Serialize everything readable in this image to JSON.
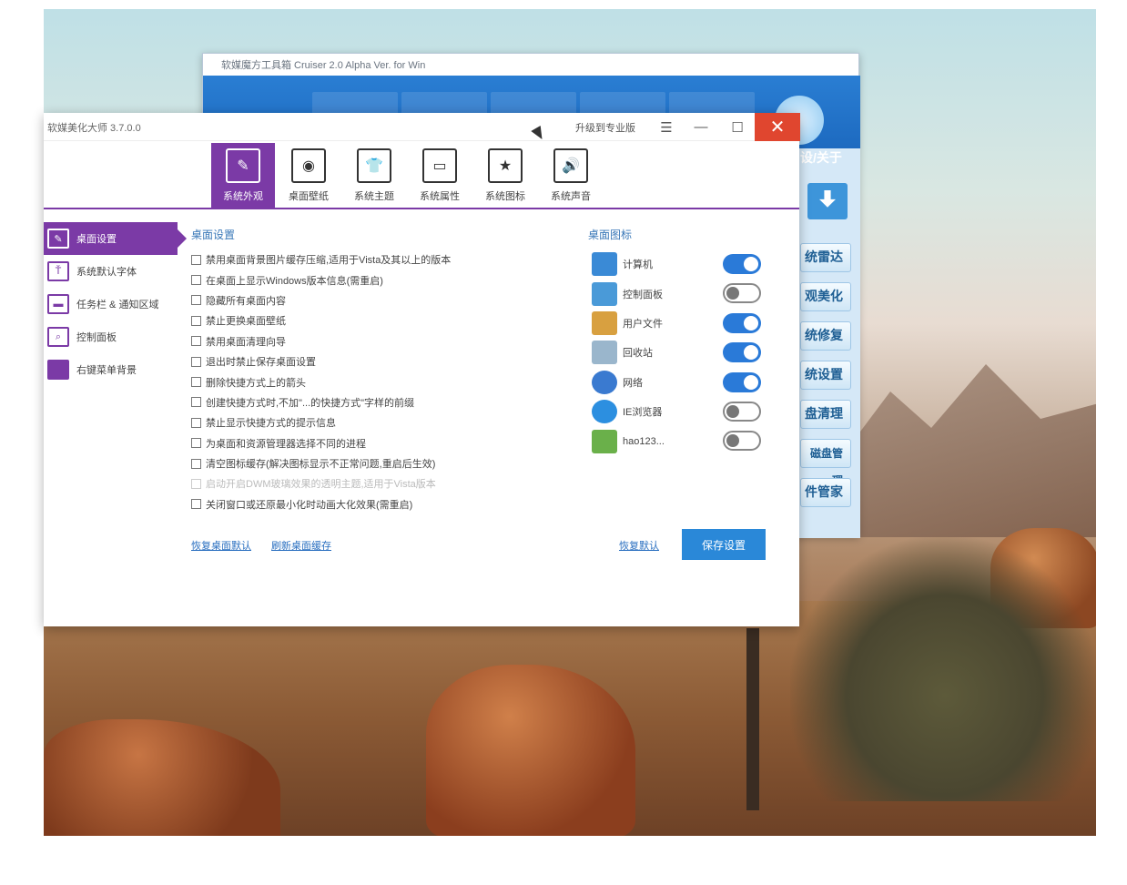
{
  "bg_window": {
    "title": "软媒魔方工具箱 Cruiser 2.0 Alpha Ver. for Win",
    "about": "设/关于",
    "side_buttons": [
      "统雷达",
      "观美化",
      "统修复",
      "统设置",
      "盘清理",
      "磁盘管理",
      "件管家"
    ]
  },
  "window": {
    "title": "软媒美化大师 3.7.0.0",
    "upgrade_link": "升级到专业版",
    "menu_icon": "menu-icon",
    "minimize_icon": "minimize-icon",
    "maximize_icon": "maximize-icon",
    "close_icon": "close-icon",
    "close_color": "#e0462f",
    "accent_color": "#7b3aa6"
  },
  "top_tabs": [
    {
      "label": "系统外观",
      "icon": "brush-icon",
      "glyph": "✎"
    },
    {
      "label": "桌面壁纸",
      "icon": "wallpaper-icon",
      "glyph": "◉"
    },
    {
      "label": "系统主题",
      "icon": "theme-icon",
      "glyph": "👕"
    },
    {
      "label": "系统属性",
      "icon": "properties-icon",
      "glyph": "▭"
    },
    {
      "label": "系统图标",
      "icon": "star-icon",
      "glyph": "★"
    },
    {
      "label": "系统声音",
      "icon": "sound-icon",
      "glyph": "🔊"
    }
  ],
  "sidebar": [
    {
      "label": "桌面设置",
      "icon": "desktop-settings-icon",
      "glyph": "✎"
    },
    {
      "label": "系统默认字体",
      "icon": "font-icon",
      "glyph": "Ť"
    },
    {
      "label": "任务栏 & 通知区域",
      "icon": "taskbar-icon",
      "glyph": "▬"
    },
    {
      "label": "控制面板",
      "icon": "control-panel-icon",
      "glyph": "⌕"
    },
    {
      "label": "右键菜单背景",
      "icon": "context-menu-icon",
      "glyph": ""
    }
  ],
  "desktop_settings": {
    "title": "桌面设置",
    "options": [
      {
        "label": "禁用桌面背景图片缓存压缩,适用于Vista及其以上的版本",
        "disabled": false
      },
      {
        "label": "在桌面上显示Windows版本信息(需重启)",
        "disabled": false
      },
      {
        "label": "隐藏所有桌面内容",
        "disabled": false
      },
      {
        "label": "禁止更换桌面壁纸",
        "disabled": false
      },
      {
        "label": "禁用桌面清理向导",
        "disabled": false
      },
      {
        "label": "退出时禁止保存桌面设置",
        "disabled": false
      },
      {
        "label": "删除快捷方式上的箭头",
        "disabled": false
      },
      {
        "label": "创建快捷方式时,不加\"...的快捷方式\"字样的前缀",
        "disabled": false
      },
      {
        "label": "禁止显示快捷方式的提示信息",
        "disabled": false
      },
      {
        "label": "为桌面和资源管理器选择不同的进程",
        "disabled": false
      },
      {
        "label": "清空图标缓存(解决图标显示不正常问题,重启后生效)",
        "disabled": false
      },
      {
        "label": "启动开启DWM玻璃效果的透明主题,适用于Vista版本",
        "disabled": true
      },
      {
        "label": "关闭窗口或还原最小化时动画大化效果(需重启)",
        "disabled": false
      }
    ]
  },
  "desktop_icons": {
    "title": "桌面图标",
    "items": [
      {
        "label": "计算机",
        "icon": "computer-icon",
        "on": true,
        "color": "#3a8ad6"
      },
      {
        "label": "控制面板",
        "icon": "control-panel-icon",
        "on": false,
        "color": "#4a9ad8"
      },
      {
        "label": "用户文件",
        "icon": "user-files-icon",
        "on": true,
        "color": "#d8a040"
      },
      {
        "label": "回收站",
        "icon": "recycle-bin-icon",
        "on": true,
        "color": "#9ab6cc"
      },
      {
        "label": "网络",
        "icon": "network-icon",
        "on": true,
        "color": "#3a7ad0"
      },
      {
        "label": "IE浏览器",
        "icon": "ie-icon",
        "on": false,
        "color": "#2c8fe0"
      },
      {
        "label": "hao123...",
        "icon": "hao123-icon",
        "on": false,
        "color": "#6ab04a"
      }
    ]
  },
  "footer": {
    "restore_link": "恢复桌面默认",
    "refresh_link": "刷新桌面缓存",
    "reset_link": "恢复默认",
    "save_button": "保存设置"
  }
}
